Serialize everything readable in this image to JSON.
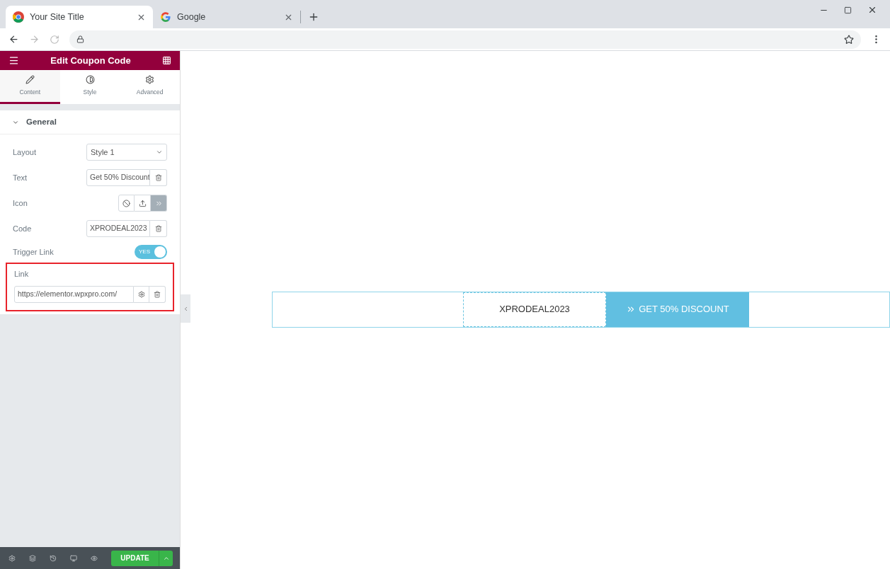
{
  "browser": {
    "tabs": [
      {
        "title": "Your Site Title",
        "selected": true,
        "kind": "chrome"
      },
      {
        "title": "Google",
        "selected": false,
        "kind": "google"
      }
    ]
  },
  "editor": {
    "title": "Edit Coupon Code",
    "tabs": [
      {
        "label": "Content",
        "selected": true,
        "kind": "pencil"
      },
      {
        "label": "Style",
        "selected": false,
        "kind": "contrast"
      },
      {
        "label": "Advanced",
        "selected": false,
        "kind": "gear"
      }
    ],
    "section": {
      "title": "General",
      "expanded": true
    },
    "controls": [
      {
        "kind": "select",
        "label": "Layout",
        "value": "Style 1"
      },
      {
        "kind": "text",
        "label": "Text",
        "value": "Get 50% Discount"
      },
      {
        "kind": "icon_choice",
        "label": "Icon",
        "options": [
          {
            "kind": "none",
            "selected": false
          },
          {
            "kind": "upload",
            "selected": false
          },
          {
            "kind": "chevrons",
            "selected": true
          }
        ]
      },
      {
        "kind": "text",
        "label": "Code",
        "value": "XPRODEAL2023"
      },
      {
        "kind": "switch",
        "label": "Trigger Link",
        "on": true,
        "on_label": "YES"
      },
      {
        "kind": "url",
        "label": "Link",
        "value": "https://elementor.wpxpro.com/",
        "highlighted": true
      }
    ],
    "update_label": "UPDATE"
  },
  "preview": {
    "code": "XPRODEAL2023",
    "button": "GET 50% DISCOUNT"
  }
}
